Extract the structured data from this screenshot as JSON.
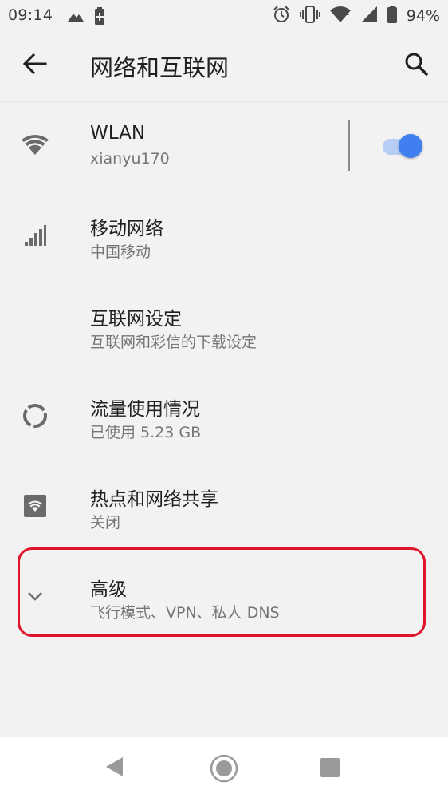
{
  "status_bar": {
    "time": "09:14",
    "battery_percent": "94%",
    "left_icons": [
      "mountain-icon",
      "battery-saver-icon"
    ],
    "right_icons": [
      "alarm-icon",
      "vibrate-icon",
      "wifi-icon",
      "cellular-icon",
      "battery-icon"
    ]
  },
  "app_bar": {
    "title": "网络和互联网",
    "back_icon": "arrow-back-icon",
    "search_icon": "search-icon"
  },
  "settings": {
    "items": [
      {
        "icon": "wifi-icon",
        "title": "WLAN",
        "summary": "xianyu170",
        "toggle_on": true
      },
      {
        "icon": "cellular-signal-icon",
        "title": "移动网络",
        "summary": "中国移动"
      },
      {
        "icon": "",
        "title": "互联网设定",
        "summary": "互联网和彩信的下载设定"
      },
      {
        "icon": "data-usage-icon",
        "title": "流量使用情况",
        "summary": "已使用 5.23 GB"
      },
      {
        "icon": "hotspot-icon",
        "title": "热点和网络共享",
        "summary": "关闭"
      },
      {
        "icon": "chevron-down-icon",
        "title": "高级",
        "summary": "飞行模式、VPN、私人 DNS"
      }
    ]
  },
  "colors": {
    "accent": "#3f7ff0",
    "highlight": "#e0142a",
    "background": "#f2f2f2"
  },
  "nav_bar": {
    "icons": [
      "nav-back-icon",
      "nav-home-icon",
      "nav-recents-icon"
    ]
  }
}
